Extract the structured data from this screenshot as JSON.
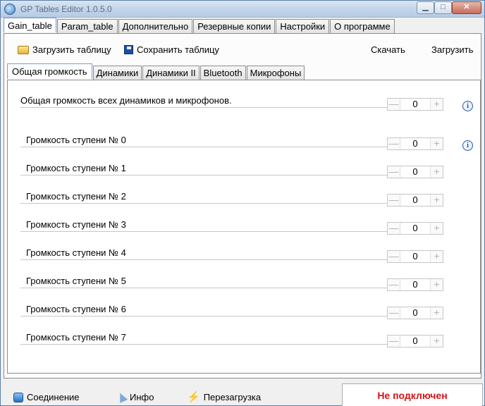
{
  "window": {
    "title": "GP Tables Editor 1.0.5.0"
  },
  "main_tabs": [
    {
      "label": "Gain_table"
    },
    {
      "label": "Param_table"
    },
    {
      "label": "Дополнительно"
    },
    {
      "label": "Резервные копии"
    },
    {
      "label": "Настройки"
    },
    {
      "label": "О программе"
    }
  ],
  "toolbar": {
    "load_label": "Загрузить таблицу",
    "save_label": "Сохранить таблицу",
    "download_label": "Скачать",
    "upload_label": "Загрузить"
  },
  "sub_tabs": [
    {
      "label": "Общая громкость"
    },
    {
      "label": "Динамики"
    },
    {
      "label": "Динамики II"
    },
    {
      "label": "Bluetooth"
    },
    {
      "label": "Микрофоны"
    }
  ],
  "rows": [
    {
      "label": "Общая громкость всех динамиков и микрофонов.",
      "value": "0"
    },
    {
      "label": "Громкость ступени № 0",
      "value": "0"
    },
    {
      "label": "Громкость ступени № 1",
      "value": "0"
    },
    {
      "label": "Громкость ступени № 2",
      "value": "0"
    },
    {
      "label": "Громкость ступени № 3",
      "value": "0"
    },
    {
      "label": "Громкость ступени № 4",
      "value": "0"
    },
    {
      "label": "Громкость ступени № 5",
      "value": "0"
    },
    {
      "label": "Громкость ступени № 6",
      "value": "0"
    },
    {
      "label": "Громкость ступени № 7",
      "value": "0"
    }
  ],
  "stepper": {
    "minus": "—",
    "plus": "+"
  },
  "info_glyph": "i",
  "statusbar": {
    "connection_label": "Соединение",
    "info_label": "Инфо",
    "reboot_label": "Перезагрузка",
    "status_text": "Не подключен"
  },
  "colors": {
    "status_text": "#d41414",
    "accent": "#7a9ec3"
  }
}
